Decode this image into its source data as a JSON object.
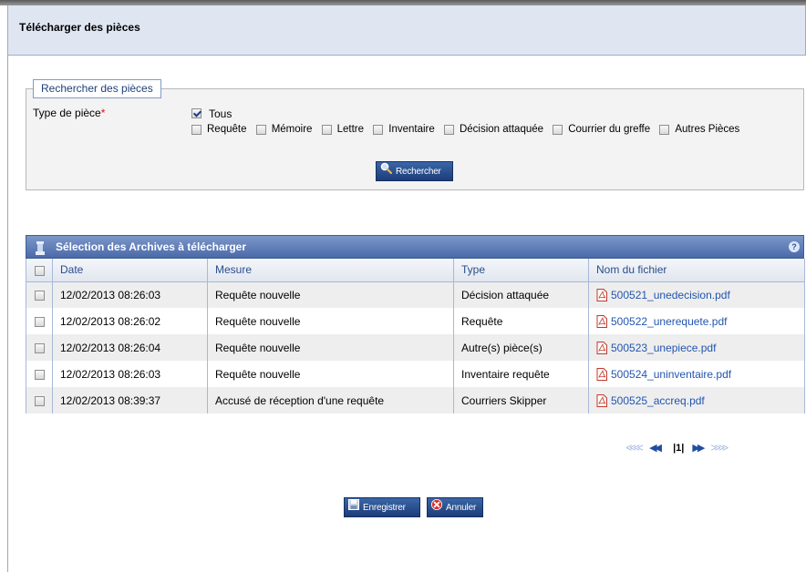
{
  "header": {
    "title": "Télécharger des pièces"
  },
  "search": {
    "legend": "Rechercher des pièces",
    "type_label": "Type de pièce",
    "required_mark": "*",
    "all": {
      "label": "Tous",
      "checked": true
    },
    "types": [
      {
        "label": "Requête",
        "checked": false
      },
      {
        "label": "Mémoire",
        "checked": false
      },
      {
        "label": "Lettre",
        "checked": false
      },
      {
        "label": "Inventaire",
        "checked": false
      },
      {
        "label": "Décision attaquée",
        "checked": false
      },
      {
        "label": "Courrier du greffe",
        "checked": false
      },
      {
        "label": "Autres Pièces",
        "checked": false
      }
    ],
    "button_label": "Rechercher"
  },
  "grid": {
    "title": "Sélection des Archives à télécharger",
    "help_glyph": "?",
    "columns": [
      "Date",
      "Mesure",
      "Type",
      "Nom du fichier"
    ],
    "rows": [
      {
        "date": "12/02/2013 08:26:03",
        "mesure": "Requête nouvelle",
        "type": "Décision attaquée",
        "file": "500521_unedecision.pdf"
      },
      {
        "date": "12/02/2013 08:26:02",
        "mesure": "Requête nouvelle",
        "type": "Requête",
        "file": "500522_unerequete.pdf"
      },
      {
        "date": "12/02/2013 08:26:04",
        "mesure": "Requête nouvelle",
        "type": "Autre(s) pièce(s)",
        "file": "500523_unepiece.pdf"
      },
      {
        "date": "12/02/2013 08:26:03",
        "mesure": "Requête nouvelle",
        "type": "Inventaire requête",
        "file": "500524_uninventaire.pdf"
      },
      {
        "date": "12/02/2013 08:39:37",
        "mesure": "Accusé de réception d'une requête",
        "type": "Courriers Skipper",
        "file": "500525_accreq.pdf"
      }
    ]
  },
  "pager": {
    "first": "≪≪",
    "prev_fast": "≪",
    "prev": "◀◀",
    "current": "|1|",
    "next": "▶▶",
    "next_fast": "≫",
    "last": "≫≫"
  },
  "footer": {
    "save_label": "Enregistrer",
    "cancel_label": "Annuler"
  },
  "colors": {
    "accent": "#2b4f92",
    "header_bg": "#dfe6f2",
    "link": "#2255b0",
    "required": "#dd1111",
    "cancel_red": "#d9322b"
  }
}
